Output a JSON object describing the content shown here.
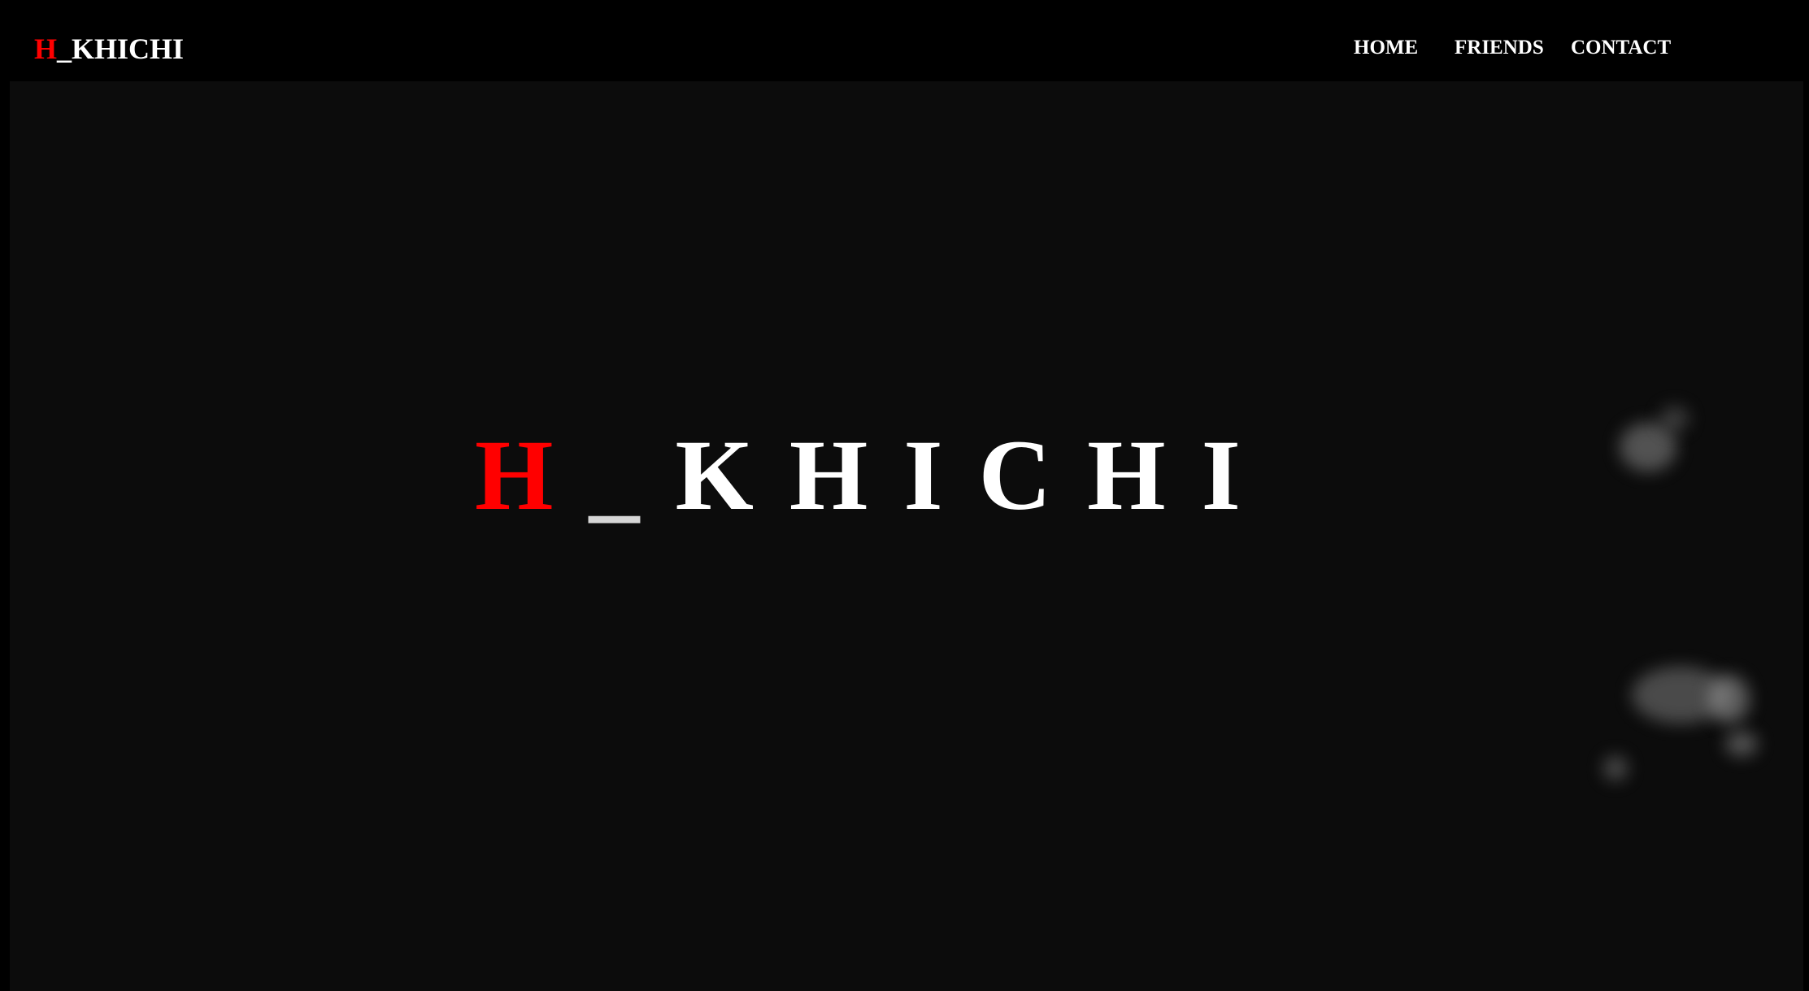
{
  "navbar": {
    "logo": {
      "accent": "H",
      "rest": "_KHICHI"
    },
    "links": [
      {
        "label": "HOME"
      },
      {
        "label": "FRIENDS"
      },
      {
        "label": "CONTACT"
      }
    ]
  },
  "hero": {
    "title_accent": "H",
    "title_underscore": "_",
    "title_rest": "KHICHI"
  },
  "colors": {
    "accent": "#ff0000",
    "text": "#ffffff",
    "background": "#0c0c0c",
    "navbar": "#000000"
  }
}
